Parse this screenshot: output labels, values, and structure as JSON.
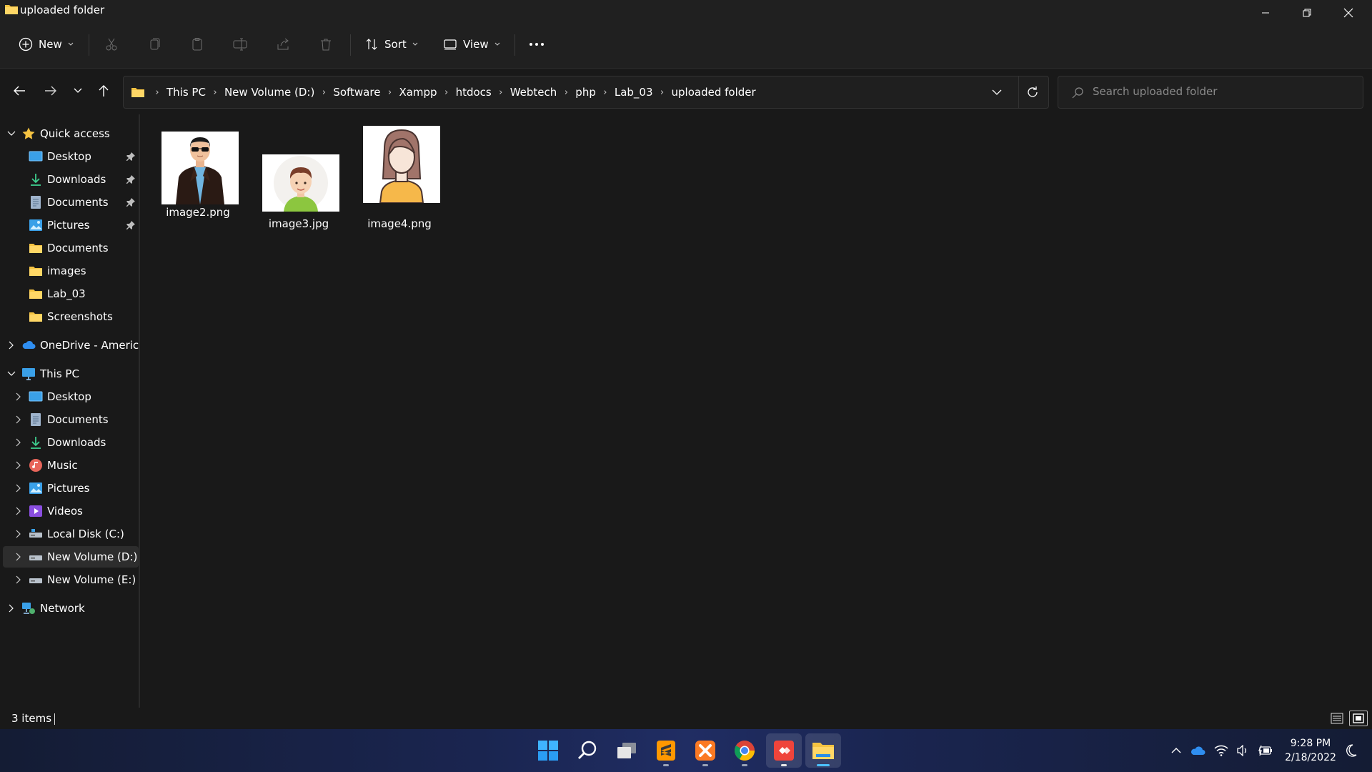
{
  "window": {
    "title": "uploaded folder"
  },
  "toolbar": {
    "new_label": "New",
    "sort_label": "Sort",
    "view_label": "View"
  },
  "breadcrumb": [
    "This PC",
    "New Volume (D:)",
    "Software",
    "Xampp",
    "htdocs",
    "Webtech",
    "php",
    "Lab_03",
    "uploaded folder"
  ],
  "search": {
    "placeholder": "Search uploaded folder"
  },
  "sidebar": {
    "quick_access": {
      "label": "Quick access",
      "items": [
        {
          "label": "Desktop",
          "icon": "desktop-icon",
          "pinned": true
        },
        {
          "label": "Downloads",
          "icon": "download-icon",
          "pinned": true
        },
        {
          "label": "Documents",
          "icon": "documents-icon",
          "pinned": true
        },
        {
          "label": "Pictures",
          "icon": "pictures-icon",
          "pinned": true
        },
        {
          "label": "Documents",
          "icon": "folder-icon",
          "pinned": false
        },
        {
          "label": "images",
          "icon": "folder-icon",
          "pinned": false
        },
        {
          "label": "Lab_03",
          "icon": "folder-icon",
          "pinned": false
        },
        {
          "label": "Screenshots",
          "icon": "folder-icon",
          "pinned": false
        }
      ]
    },
    "onedrive": {
      "label": "OneDrive - American"
    },
    "this_pc": {
      "label": "This PC",
      "items": [
        {
          "label": "Desktop",
          "icon": "desktop-icon"
        },
        {
          "label": "Documents",
          "icon": "documents-icon"
        },
        {
          "label": "Downloads",
          "icon": "download-icon"
        },
        {
          "label": "Music",
          "icon": "music-icon"
        },
        {
          "label": "Pictures",
          "icon": "pictures-icon"
        },
        {
          "label": "Videos",
          "icon": "videos-icon"
        },
        {
          "label": "Local Disk (C:)",
          "icon": "drive-icon"
        },
        {
          "label": "New Volume (D:)",
          "icon": "drive-icon",
          "selected": true
        },
        {
          "label": "New Volume (E:)",
          "icon": "drive-icon"
        }
      ]
    },
    "network": {
      "label": "Network"
    }
  },
  "files": [
    {
      "name": "image2.png",
      "thumb": "man-sunglasses-avatar"
    },
    {
      "name": "image3.jpg",
      "thumb": "boy-avatar"
    },
    {
      "name": "image4.png",
      "thumb": "woman-avatar"
    }
  ],
  "status": {
    "items_count": "3 items"
  },
  "taskbar": {
    "apps": [
      "start-icon",
      "search-icon",
      "task-view-icon",
      "sublime-text-icon",
      "xampp-icon",
      "chrome-icon",
      "anydesk-icon",
      "file-explorer-icon"
    ],
    "clock_time": "9:28 PM",
    "clock_date": "2/18/2022"
  },
  "colors": {
    "background": "#191919",
    "chrome": "#202020",
    "folder_yellow": "#f5c342",
    "accent_blue": "#4cc2ff",
    "selected_row": "#2d2d2d"
  }
}
